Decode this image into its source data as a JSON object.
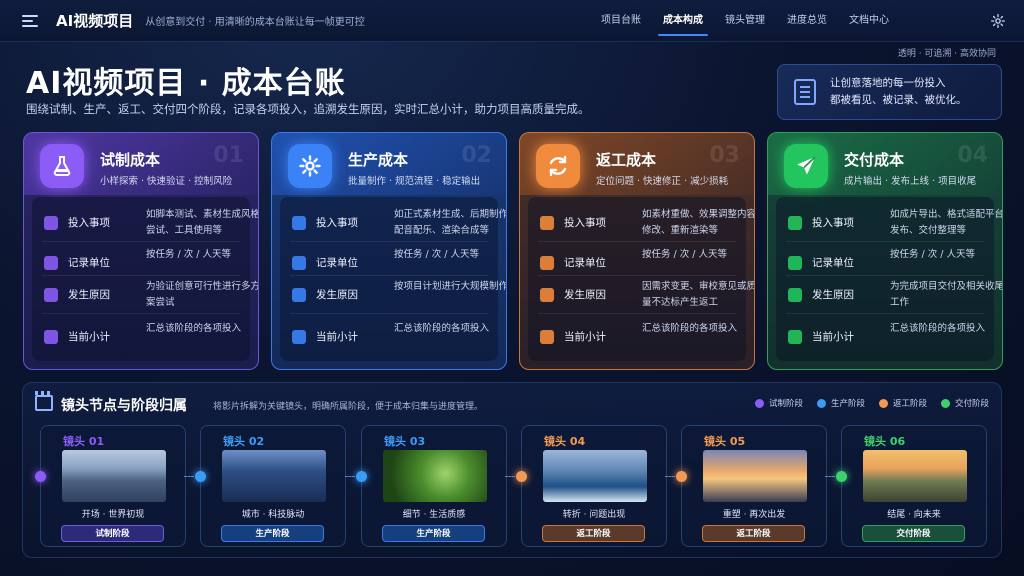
{
  "header": {
    "app_title": "AI视频项目",
    "subtitle": "从创意到交付 · 用清晰的成本台账让每一帧更可控",
    "tabs": [
      {
        "label": "项目台账"
      },
      {
        "label": "成本构成"
      },
      {
        "label": "镜头管理"
      },
      {
        "label": "进度总览"
      },
      {
        "label": "文档中心"
      }
    ],
    "active_tab": "成本构成",
    "tagline": "透明 · 可追溯 · 高效协同"
  },
  "hero": {
    "title": "AI视频项目 · 成本台账",
    "description": "围绕试制、生产、返工、交付四个阶段，记录各项投入，追溯发生原因，实时汇总小计，助力项目高质量完成。",
    "quote_line1": "让创意落地的每一份投入",
    "quote_line2": "都被看见、被记录、被优化。"
  },
  "row_labels": [
    "投入事项",
    "记录单位",
    "发生原因",
    "当前小计"
  ],
  "stages": [
    {
      "title": "试制成本",
      "subtitle": "小样探索 · 快速验证 · 控制风险",
      "number": "01",
      "accent": "#8b5cf6",
      "items": [
        "如脚本测试、素材生成风格尝试、工具使用等",
        "按任务 / 次 / 人天等",
        "为验证创意可行性进行多方案尝试",
        "汇总该阶段的各项投入"
      ]
    },
    {
      "title": "生产成本",
      "subtitle": "批量制作 · 规范流程 · 稳定输出",
      "number": "02",
      "accent": "#3b82f6",
      "items": [
        "如正式素材生成、后期制作配音配乐、渲染合成等",
        "按任务 / 次 / 人天等",
        "按项目计划进行大规模制作",
        "汇总该阶段的各项投入"
      ]
    },
    {
      "title": "返工成本",
      "subtitle": "定位问题 · 快速修正 · 减少损耗",
      "number": "03",
      "accent": "#f08a3c",
      "items": [
        "如素材重做、效果调整内容修改、重新渲染等",
        "按任务 / 次 / 人天等",
        "因需求变更、审校意见或质量不达标产生返工",
        "汇总该阶段的各项投入"
      ]
    },
    {
      "title": "交付成本",
      "subtitle": "成片输出 · 发布上线 · 项目收尾",
      "number": "04",
      "accent": "#22c55e",
      "items": [
        "如成片导出、格式适配平台发布、交付整理等",
        "按任务 / 次 / 人天等",
        "为完成项目交付及相关收尾工作",
        "汇总该阶段的各项投入"
      ]
    }
  ],
  "timeline": {
    "title": "镜头节点与阶段归属",
    "description": "将影片拆解为关键镜头，明确所属阶段，便于成本归集与进度管理。",
    "legend": [
      {
        "label": "试制阶段",
        "color": "#8b5cf6"
      },
      {
        "label": "生产阶段",
        "color": "#3b9cf6"
      },
      {
        "label": "返工阶段",
        "color": "#f29a54"
      },
      {
        "label": "交付阶段",
        "color": "#3fcf6d"
      }
    ],
    "shots": [
      {
        "label": "镜头 01",
        "caption": "开场 · 世界初现",
        "stage": "试制阶段",
        "scene": "mountains"
      },
      {
        "label": "镜头 02",
        "caption": "城市 · 科技脉动",
        "stage": "生产阶段",
        "scene": "city"
      },
      {
        "label": "镜头 03",
        "caption": "细节 · 生活质感",
        "stage": "生产阶段",
        "scene": "leaf"
      },
      {
        "label": "镜头 04",
        "caption": "转折 · 问题出现",
        "stage": "返工阶段",
        "scene": "wave"
      },
      {
        "label": "镜头 05",
        "caption": "重塑 · 再次出发",
        "stage": "返工阶段",
        "scene": "sunset"
      },
      {
        "label": "镜头 06",
        "caption": "结尾 · 向未来",
        "stage": "交付阶段",
        "scene": "road"
      }
    ]
  }
}
